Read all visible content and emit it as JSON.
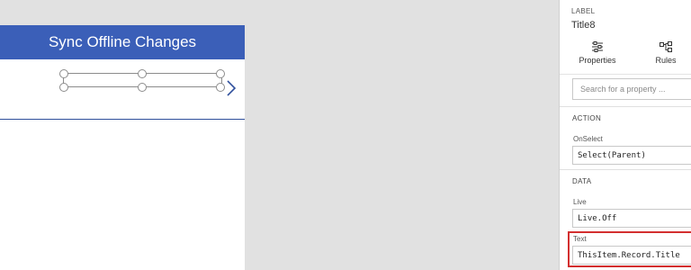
{
  "app": {
    "header_title": "Sync Offline Changes"
  },
  "panel": {
    "label_caption": "LABEL",
    "control_name": "Title8",
    "tabs": [
      {
        "label": "Properties",
        "icon": "sliders-icon"
      },
      {
        "label": "Rules",
        "icon": "rules-flow-icon"
      }
    ],
    "search_placeholder": "Search for a property ...",
    "sections": {
      "action": {
        "title": "ACTION",
        "properties": [
          {
            "label": "OnSelect",
            "value": "Select(Parent)"
          }
        ]
      },
      "data": {
        "title": "DATA",
        "properties": [
          {
            "label": "Live",
            "value": "Live.Off"
          },
          {
            "label": "Text",
            "value": "ThisItem.Record.Title"
          }
        ]
      }
    }
  },
  "colors": {
    "header_bg": "#3b5fb8",
    "highlight": "#d32f2f"
  }
}
